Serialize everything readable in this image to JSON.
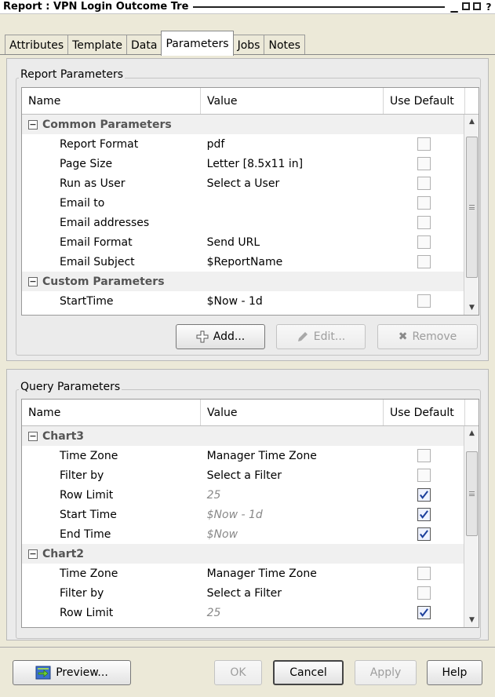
{
  "window": {
    "title": "Report : VPN Login Outcome Tre",
    "controls": [
      "minimize",
      "restore",
      "maximize",
      "help"
    ]
  },
  "tabs": [
    {
      "label": "Attributes",
      "active": false
    },
    {
      "label": "Template",
      "active": false
    },
    {
      "label": "Data",
      "active": false
    },
    {
      "label": "Parameters",
      "active": true
    },
    {
      "label": "Jobs",
      "active": false
    },
    {
      "label": "Notes",
      "active": false
    }
  ],
  "report_parameters": {
    "group_label": "Report Parameters",
    "columns": {
      "name": "Name",
      "value": "Value",
      "default": "Use Default"
    },
    "sections": [
      {
        "title": "Common Parameters",
        "rows": [
          {
            "name": "Report Format",
            "value": "pdf",
            "use_default": false,
            "italic": false
          },
          {
            "name": "Page Size",
            "value": "Letter [8.5x11 in]",
            "use_default": false,
            "italic": false
          },
          {
            "name": "Run as User",
            "value": "Select a User",
            "use_default": false,
            "italic": false
          },
          {
            "name": "Email to",
            "value": "",
            "use_default": false,
            "italic": false
          },
          {
            "name": "Email addresses",
            "value": "",
            "use_default": false,
            "italic": false
          },
          {
            "name": "Email Format",
            "value": "Send URL",
            "use_default": false,
            "italic": false
          },
          {
            "name": "Email Subject",
            "value": "$ReportName",
            "use_default": false,
            "italic": false
          }
        ]
      },
      {
        "title": "Custom Parameters",
        "rows": [
          {
            "name": "StartTime",
            "value": "$Now - 1d",
            "use_default": false,
            "italic": false
          }
        ]
      }
    ],
    "buttons": {
      "add": "Add...",
      "edit": "Edit...",
      "remove": "Remove"
    }
  },
  "query_parameters": {
    "group_label": "Query Parameters",
    "columns": {
      "name": "Name",
      "value": "Value",
      "default": "Use Default"
    },
    "sections": [
      {
        "title": "Chart3",
        "rows": [
          {
            "name": "Time Zone",
            "value": "Manager Time Zone",
            "use_default": false,
            "italic": false
          },
          {
            "name": "Filter by",
            "value": "Select a Filter",
            "use_default": false,
            "italic": false
          },
          {
            "name": "Row Limit",
            "value": "25",
            "use_default": true,
            "italic": true
          },
          {
            "name": "Start Time",
            "value": "$Now - 1d",
            "use_default": true,
            "italic": true
          },
          {
            "name": "End Time",
            "value": "$Now",
            "use_default": true,
            "italic": true
          }
        ]
      },
      {
        "title": "Chart2",
        "rows": [
          {
            "name": "Time Zone",
            "value": "Manager Time Zone",
            "use_default": false,
            "italic": false
          },
          {
            "name": "Filter by",
            "value": "Select a Filter",
            "use_default": false,
            "italic": false
          },
          {
            "name": "Row Limit",
            "value": "25",
            "use_default": true,
            "italic": true
          }
        ]
      }
    ]
  },
  "footer": {
    "preview": "Preview...",
    "ok": "OK",
    "cancel": "Cancel",
    "apply": "Apply",
    "help": "Help"
  }
}
